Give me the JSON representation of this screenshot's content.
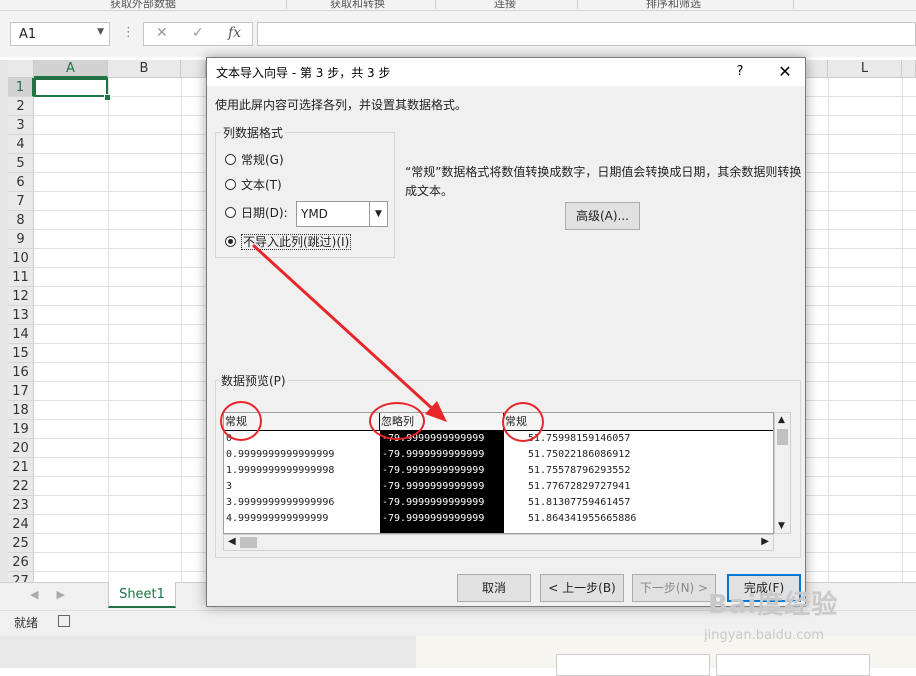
{
  "ribbon": {
    "groups": [
      "获取外部数据",
      "获取和转换",
      "连接",
      "排序和筛选"
    ]
  },
  "formula_bar": {
    "name_box": "A1",
    "fx_symbol": "fx",
    "cancel_symbol": "✕",
    "enter_symbol": "✓"
  },
  "grid": {
    "columns": [
      "A",
      "B",
      "L"
    ],
    "rows": [
      "1",
      "2",
      "3",
      "4",
      "5",
      "6",
      "7",
      "8",
      "9",
      "10",
      "11",
      "12",
      "13",
      "14",
      "15",
      "16",
      "17",
      "18",
      "19",
      "20",
      "21",
      "22",
      "23",
      "24",
      "25",
      "26",
      "27"
    ],
    "selected_cell": "A1"
  },
  "sheet_tabs": {
    "active": "Sheet1"
  },
  "status": {
    "ready": "就绪"
  },
  "dialog": {
    "title": "文本导入向导 - 第 3 步，共 3 步",
    "help": "?",
    "close": "✕",
    "instruction": "使用此屏内容可选择各列，并设置其数据格式。",
    "column_format": {
      "legend": "列数据格式",
      "options": [
        {
          "label": "常规(G)",
          "selected": false
        },
        {
          "label": "文本(T)",
          "selected": false
        },
        {
          "label": "日期(D):",
          "selected": false
        },
        {
          "label": "不导入此列(跳过)(I)",
          "selected": true
        }
      ],
      "date_format": "YMD"
    },
    "description": "“常规”数据格式将数值转换成数字，日期值会转换成日期，其余数据则转换成文本。",
    "advanced_button": "高级(A)...",
    "preview": {
      "legend": "数据预览(P)",
      "headers": [
        "常规",
        "忽略列",
        "常规"
      ],
      "rows": [
        [
          "0",
          "-79.9999999999999",
          "51.75998159146057"
        ],
        [
          "0.9999999999999999",
          "-79.9999999999999",
          "51.75022186086912"
        ],
        [
          "1.9999999999999998",
          "-79.9999999999999",
          "51.75578796293552"
        ],
        [
          "3",
          "-79.9999999999999",
          "51.77672829727941"
        ],
        [
          "3.9999999999999996",
          "-79.9999999999999",
          "51.81307759461457"
        ],
        [
          "4.999999999999999",
          "-79.9999999999999",
          "51.864341955665886"
        ]
      ]
    },
    "buttons": {
      "cancel": "取消",
      "back": "< 上一步(B)",
      "next": "下一步(N) >",
      "finish": "完成(F)"
    }
  },
  "annotation_color": "#e8262a",
  "accent_color": "#217346",
  "watermark": {
    "text": "Bai度经验",
    "url": "jingyan.baidu.com"
  }
}
